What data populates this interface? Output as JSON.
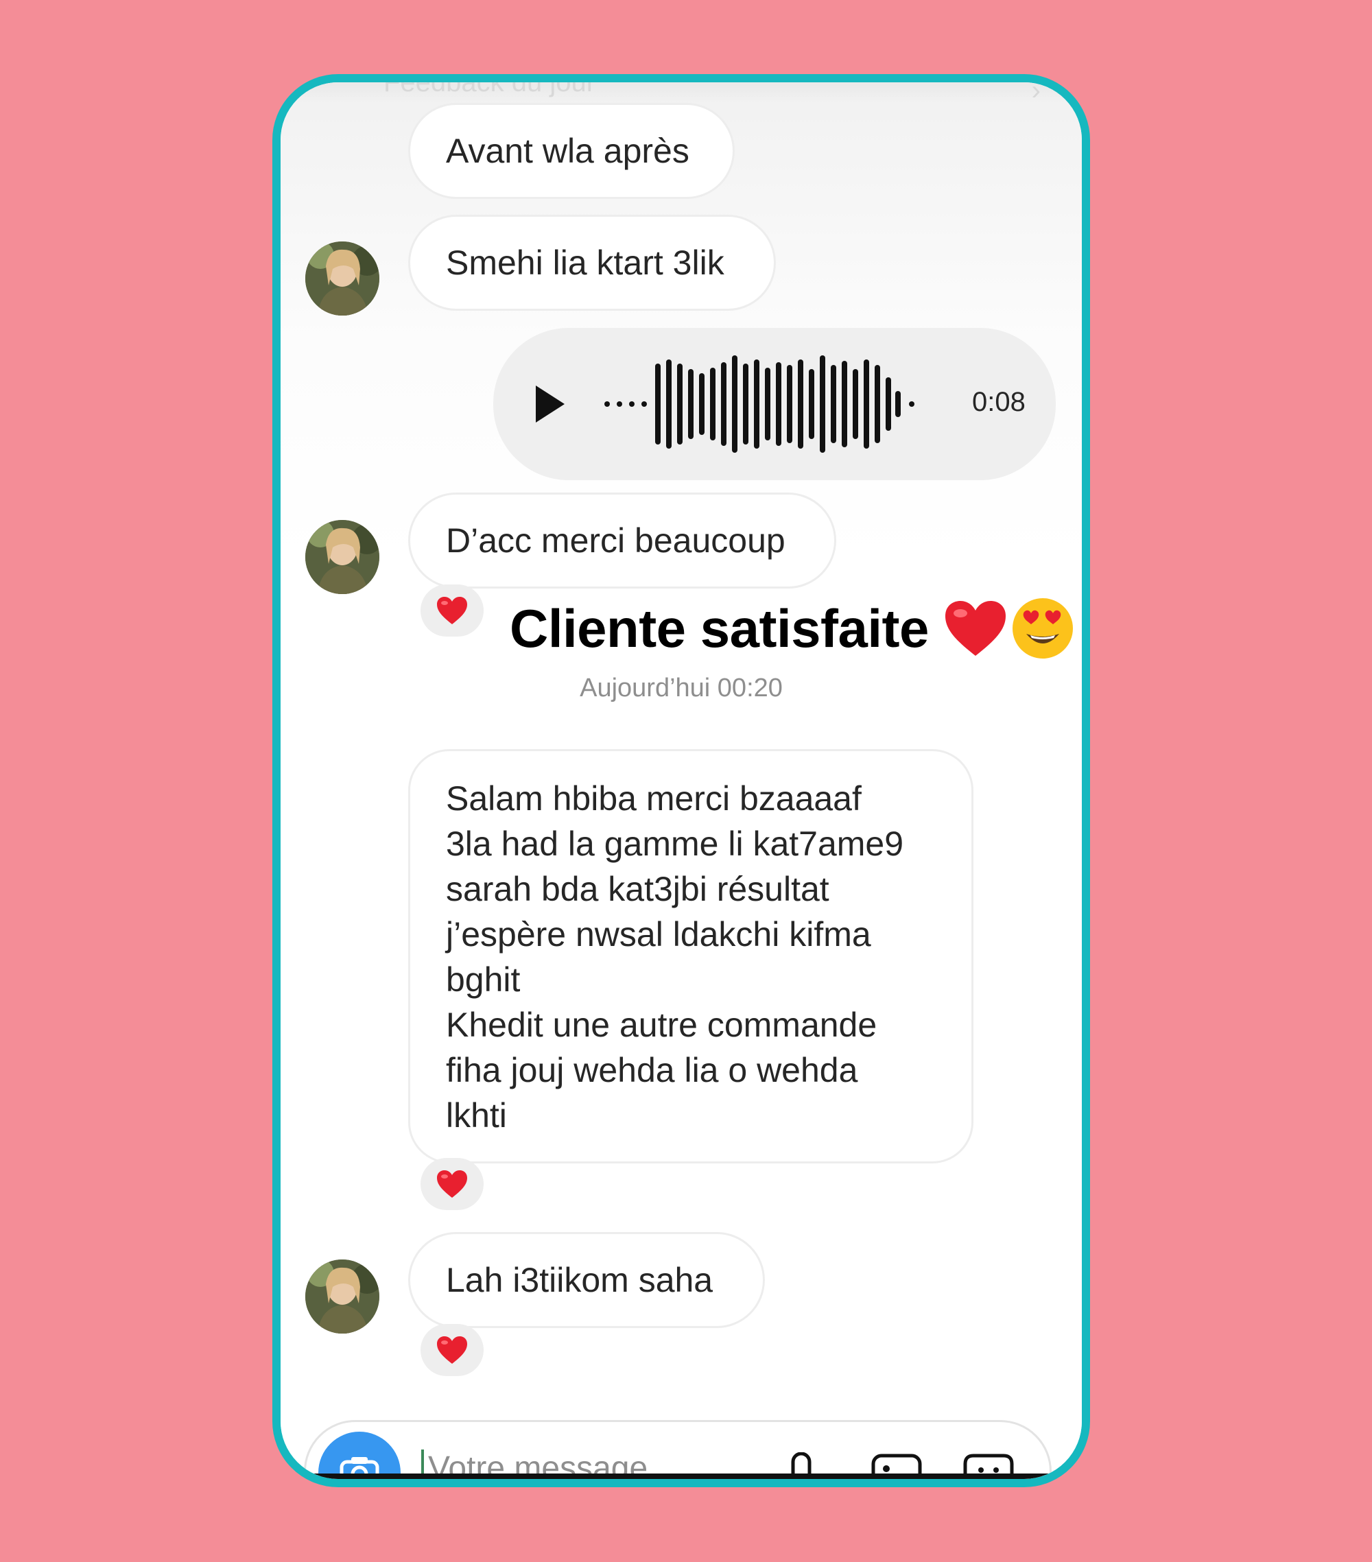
{
  "topbar": {
    "title": "Feedback du jour"
  },
  "messages": {
    "m1": "Avant wla après",
    "m2": "Smehi lia ktart 3lik",
    "voice": {
      "duration": "0:08"
    },
    "m3": "D’acc merci beaucoup",
    "m4": {
      "lines": [
        "Salam hbiba merci bzaaaaf",
        "3la had la gamme li kat7ame9",
        "sarah bda kat3jbi résultat",
        "j’espère nwsal ldakchi kifma",
        "bghit",
        "Khedit une autre commande",
        "fiha jouj wehda lia o wehda",
        "lkhti"
      ]
    },
    "m5": "Lah i3tiikom saha"
  },
  "headline": {
    "text": "Cliente satisfaite"
  },
  "timestamp": "Aujourd’hui 00:20",
  "composer": {
    "placeholder": "Votre message..."
  },
  "colors": {
    "background": "#f48d97",
    "frame": "#16b8bf",
    "heart": "#e8202f",
    "camera_button": "#3797f0"
  },
  "icons": [
    "play-icon",
    "heart-icon",
    "heart-eyes-emoji",
    "camera-icon",
    "microphone-icon",
    "gallery-icon",
    "sticker-icon"
  ]
}
